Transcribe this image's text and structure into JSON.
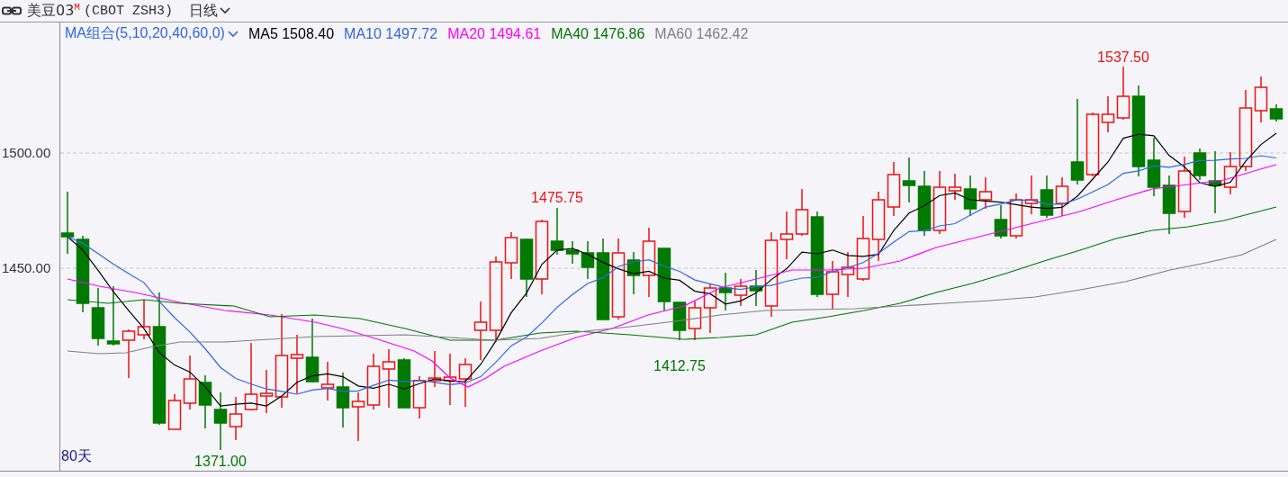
{
  "header": {
    "symbol": "美豆03",
    "symbol_mark": "M",
    "code": "(CBOT ZSH3)",
    "period": "日线"
  },
  "legend": {
    "group": "MA组合(5,10,20,40,60,0)",
    "items": [
      {
        "name": "MA5",
        "value": "1508.40",
        "color": "#000000"
      },
      {
        "name": "MA10",
        "value": "1497.72",
        "color": "#3366dd"
      },
      {
        "name": "MA20",
        "value": "1494.61",
        "color": "#ff00ff"
      },
      {
        "name": "MA40",
        "value": "1476.86",
        "color": "#007700"
      },
      {
        "name": "MA60",
        "value": "1462.42",
        "color": "#808080"
      }
    ]
  },
  "y_axis": {
    "labels": [
      "1500.00",
      "1450.00"
    ]
  },
  "price_labels": [
    {
      "text": "1537.50",
      "kind": "high"
    },
    {
      "text": "1475.75",
      "kind": "high"
    },
    {
      "text": "1412.75",
      "kind": "low"
    },
    {
      "text": "1371.00",
      "kind": "low"
    }
  ],
  "range_label": "80天"
}
